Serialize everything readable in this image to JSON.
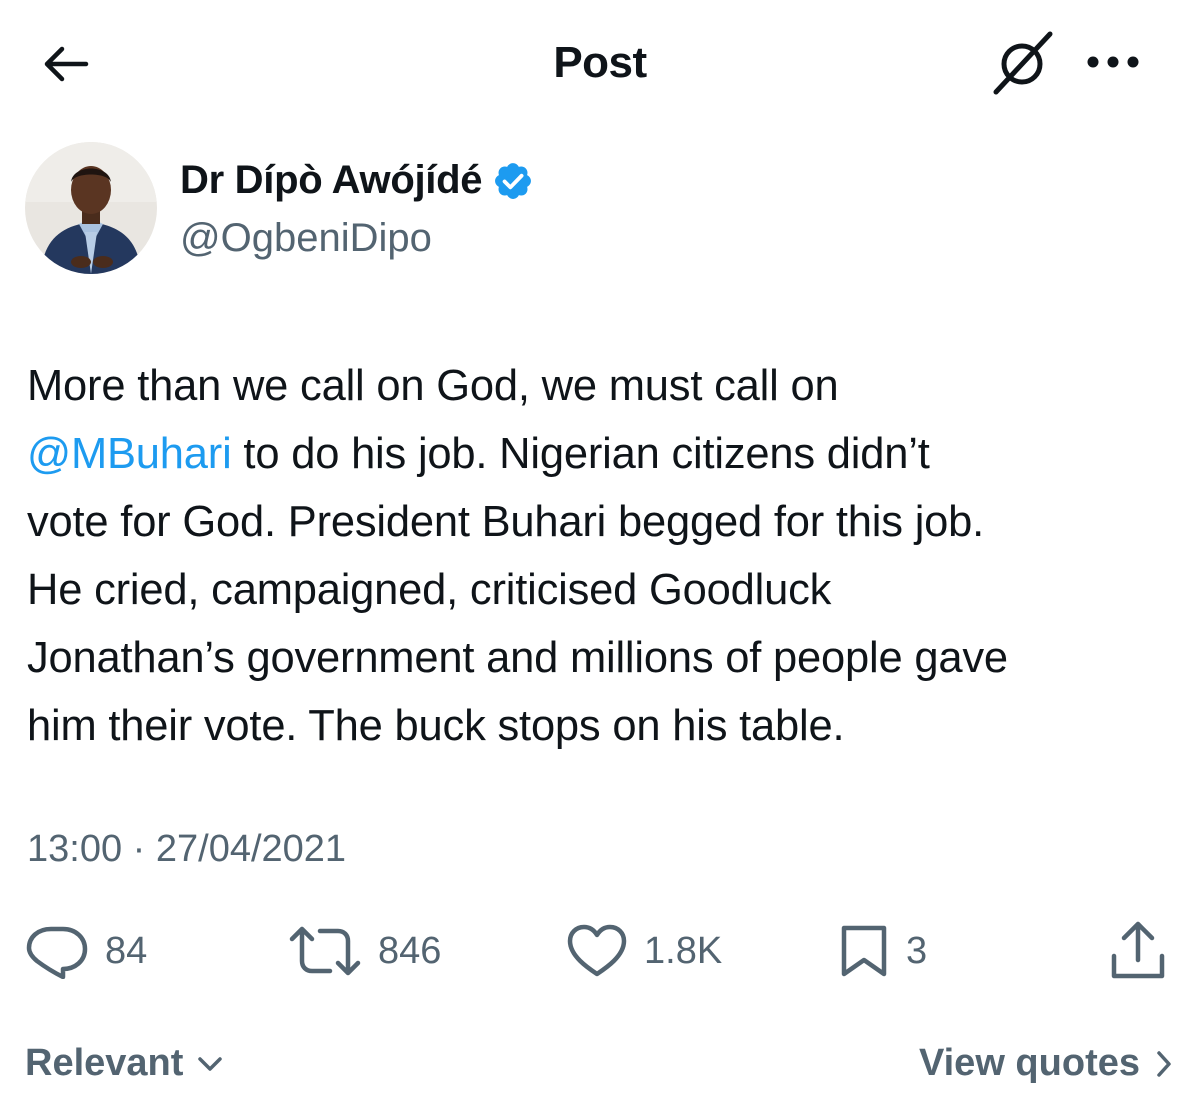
{
  "header": {
    "title": "Post",
    "back_icon": "arrow-left-icon",
    "grok_icon": "grok-icon",
    "more_icon": "more-horizontal-icon"
  },
  "author": {
    "display_name": "Dr Dípò Awójídé",
    "handle": "@OgbeniDipo",
    "verified": true
  },
  "tweet": {
    "line1": "More than we call on God, we must call on",
    "mention": "@MBuhari",
    "line2_rest": " to do his job. Nigerian citizens didn’t",
    "line3": "vote for God. President Buhari begged for this job.",
    "line4": "He cried, campaigned, criticised Goodluck",
    "line5": "Jonathan’s government and millions of people gave",
    "line6": "him their vote. The buck stops on his table.",
    "timestamp": "13:00 · 27/04/2021"
  },
  "actions": {
    "replies": "84",
    "reposts": "846",
    "likes": "1.8K",
    "bookmarks": "3"
  },
  "footer": {
    "sort_label": "Relevant",
    "view_quotes_label": "View quotes"
  },
  "colors": {
    "text": "#0f1419",
    "secondary": "#536471",
    "accent": "#1d9bf0"
  }
}
